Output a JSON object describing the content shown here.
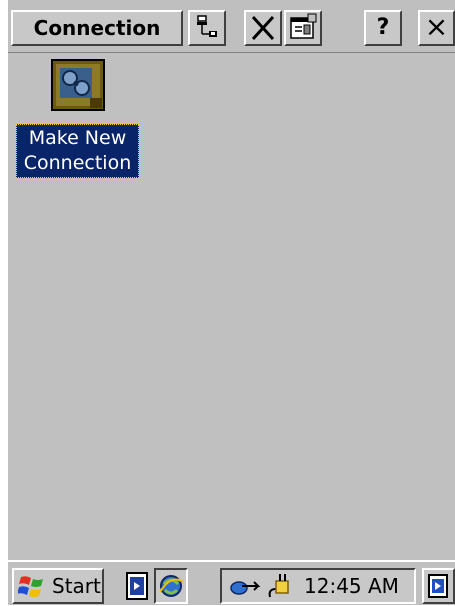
{
  "titlebar": {
    "title": "Connection",
    "help_label": "?",
    "close_label": "×"
  },
  "desktop": {
    "icon_label_line1": "Make New",
    "icon_label_line2": "Connection"
  },
  "taskbar": {
    "start_label": "Start",
    "clock": "12:45 AM"
  },
  "colors": {
    "background": "#c0c0c0",
    "selection": "#0a246a",
    "selection_text": "#ffffff"
  },
  "icons": [
    "network-properties-icon",
    "delete-icon",
    "properties-icon",
    "make-new-connection-icon",
    "windows-flag-icon",
    "desktop-switch-icon",
    "internet-explorer-icon",
    "network-tray-icon",
    "power-plug-icon",
    "show-desktop-icon"
  ]
}
